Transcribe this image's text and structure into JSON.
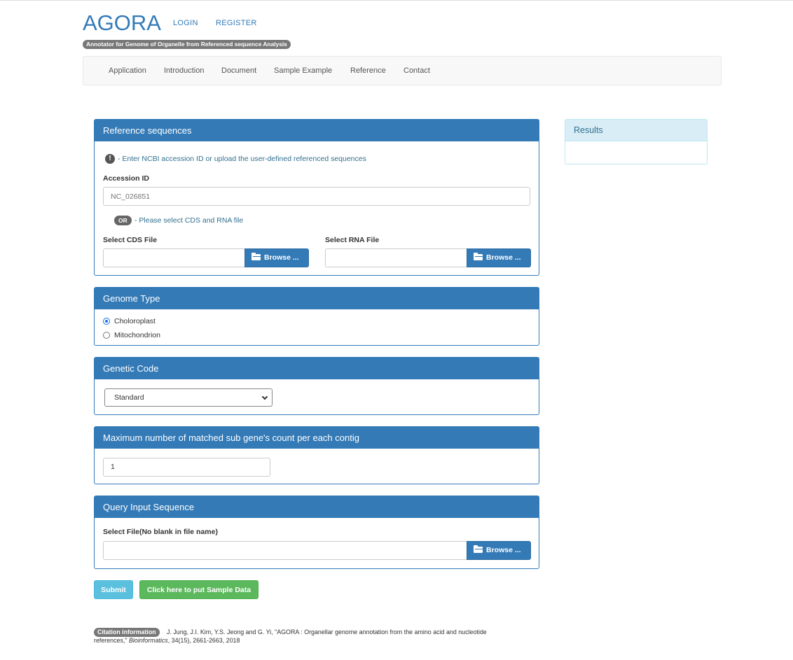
{
  "header": {
    "brand": "AGORA",
    "login": "LOGIN",
    "register": "REGISTER",
    "tagline": "Annotator for Genome of Organelle from Referenced sequence Analysis"
  },
  "nav": {
    "items": [
      "Application",
      "Introduction",
      "Document",
      "Sample Example",
      "Reference",
      "Contact"
    ]
  },
  "reference_panel": {
    "title": "Reference sequences",
    "info": "- Enter NCBI accession ID or upload the user-defined referenced sequences",
    "accession_label": "Accession ID",
    "accession_placeholder": "NC_026851",
    "or_badge": "OR",
    "or_text": "- Please select CDS and RNA file",
    "cds_label": "Select CDS File",
    "rna_label": "Select RNA File",
    "browse": "Browse ..."
  },
  "genome_panel": {
    "title": "Genome Type",
    "options": [
      "Choloroplast",
      "Mitochondrion"
    ],
    "selected": "Choloroplast"
  },
  "genetic_panel": {
    "title": "Genetic Code",
    "selected": "Standard"
  },
  "max_panel": {
    "title": "Maximum number of matched sub gene's count per each contig",
    "value": "1"
  },
  "query_panel": {
    "title": "Query Input Sequence",
    "file_label": "Select File(No blank in file name)",
    "browse": "Browse ..."
  },
  "results": {
    "title": "Results"
  },
  "actions": {
    "submit": "Submit",
    "sample": "Click here to put Sample Data"
  },
  "citation": {
    "badge": "Citation information",
    "line1": "J. Jung, J.I. Kim, Y.S. Jeong and G. Yi, \"AGORA : Organellar genome annotation from the amino acid and nucleotide",
    "line2_pre": "references,\" ",
    "journal": "Bioinformatics",
    "line2_post": ", 34(15), 2661-2663, 2018"
  },
  "colors": {
    "primary": "#337ab7",
    "info": "#5bc0de",
    "success": "#5cb85c",
    "results_bg": "#d9edf7"
  }
}
